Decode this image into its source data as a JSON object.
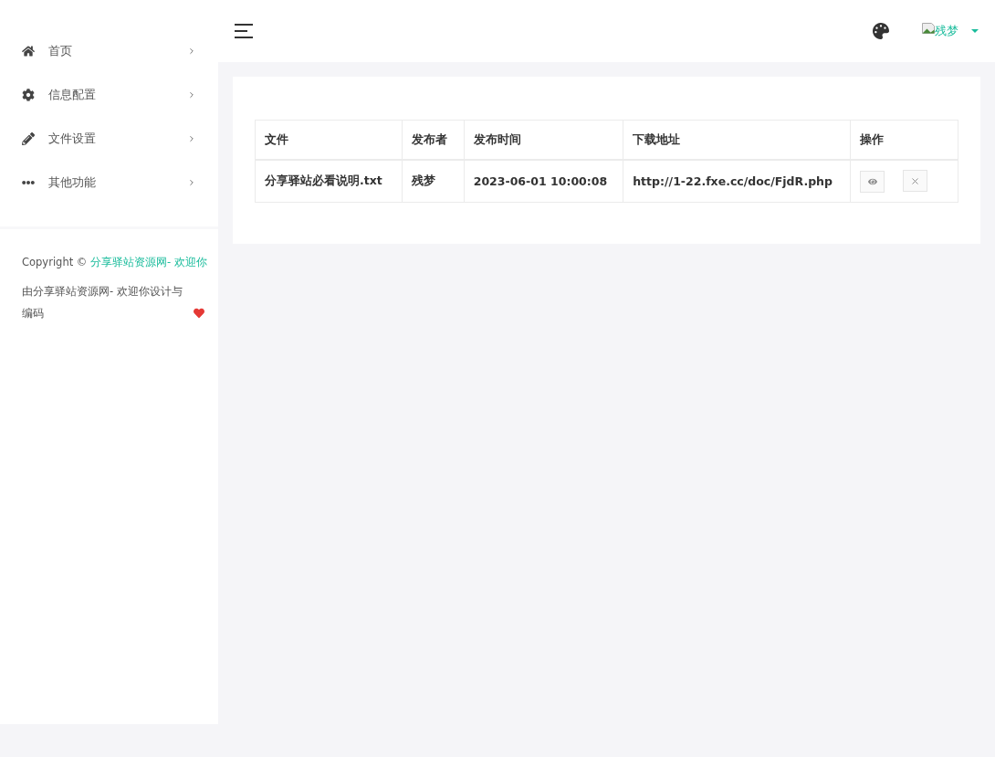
{
  "sidebar": {
    "items": [
      {
        "label": "首页",
        "expanded": false
      },
      {
        "label": "信息配置",
        "expanded": false
      },
      {
        "label": "文件设置",
        "expanded": false
      },
      {
        "label": "其他功能",
        "expanded": false
      }
    ],
    "footer": {
      "copyright": "Copyright ©",
      "link": "分享驿站资源网- 欢迎你",
      "credit": "由分享驿站资源网- 欢迎你设计与编码"
    }
  },
  "header": {
    "user": "残梦"
  },
  "table": {
    "columns": [
      "文件",
      "发布者",
      "发布时间",
      "下载地址",
      "操作"
    ],
    "rows": [
      {
        "cells": [
          "分享驿站必看说明.txt",
          "残梦",
          "2023-06-01 10:00:08",
          "http://1-22.fxe.cc/doc/FjdR.php"
        ]
      }
    ]
  }
}
